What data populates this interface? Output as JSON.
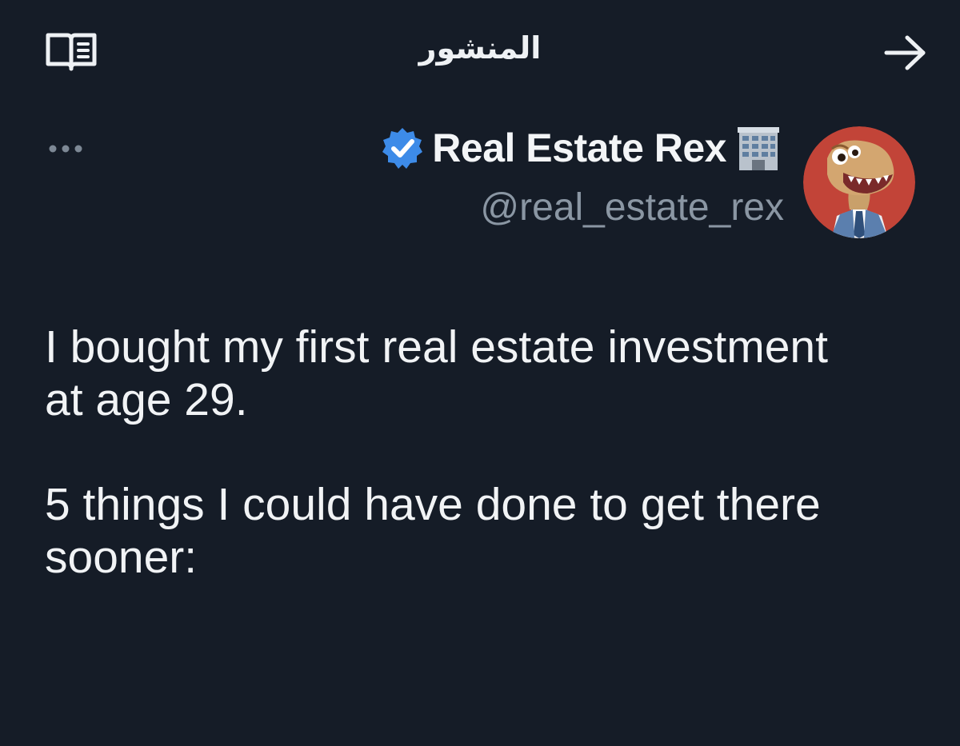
{
  "header": {
    "title": "المنشور",
    "reader_icon": "reader-mode-icon",
    "back_icon": "arrow-right-icon"
  },
  "post": {
    "author": {
      "display_name": "Real Estate Rex",
      "handle": "@real_estate_rex",
      "verified": true,
      "verified_color": "#3d8be8",
      "emoji_icon": "building-icon"
    },
    "more_icon": "more-dots-icon",
    "paragraphs": [
      "I bought my first real estate investment at age 29.",
      "5 things I could have done to get there sooner:"
    ]
  },
  "colors": {
    "background": "#151c27",
    "text": "#f1f3f5",
    "muted": "#8a96a3",
    "accent": "#3d8be8"
  }
}
